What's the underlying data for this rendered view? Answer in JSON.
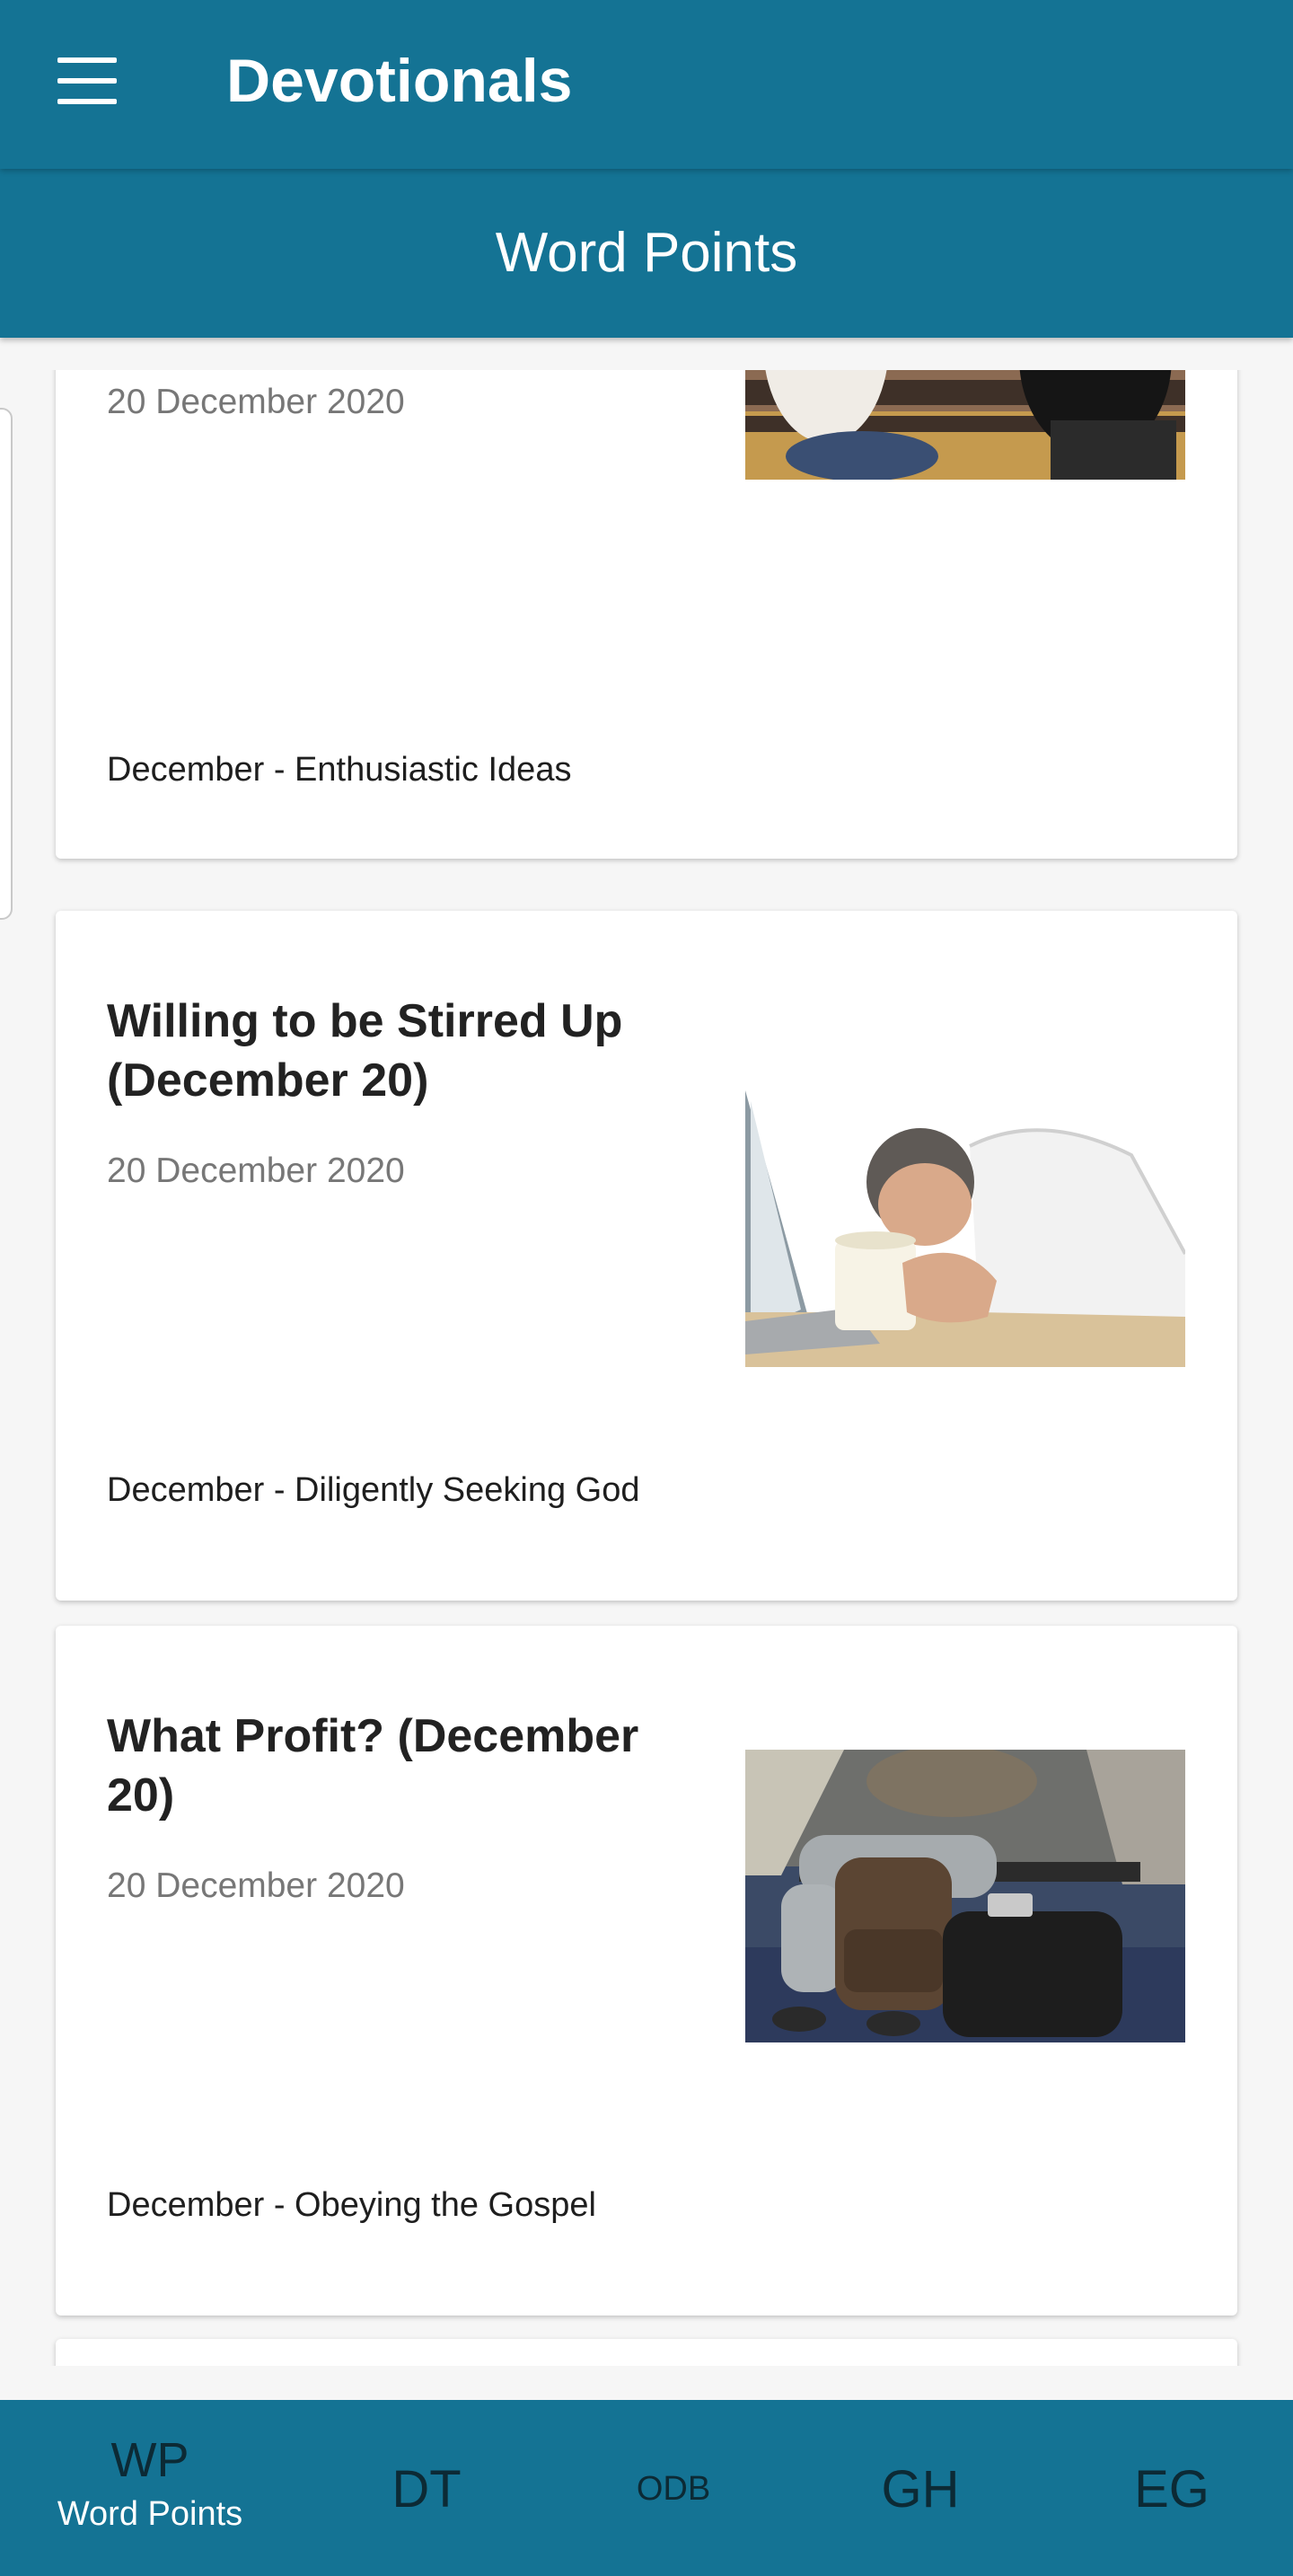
{
  "appbar": {
    "title": "Devotionals"
  },
  "subheader": {
    "title": "Word Points"
  },
  "cards": [
    {
      "date": "20 December 2020",
      "category": "December - Enthusiastic Ideas",
      "image": "two-women-on-bench"
    },
    {
      "title": "Willing to be Stirred Up (December 20)",
      "date": "20 December 2020",
      "category": "December - Diligently Seeking God",
      "image": "man-sleeping-on-laptop"
    },
    {
      "title": "What Profit? (December 20)",
      "date": "20 December 2020",
      "category": "December - Obeying the Gospel",
      "image": "traveler-with-backpack"
    }
  ],
  "nav": [
    {
      "abbr": "WP",
      "label": "Word Points",
      "active": true
    },
    {
      "abbr": "DT"
    },
    {
      "abbr": "ODB"
    },
    {
      "abbr": "GH"
    },
    {
      "abbr": "EG"
    }
  ],
  "colors": {
    "primary": "#147394",
    "nav_text": "#0c2a35",
    "background": "#f6f6f6"
  }
}
